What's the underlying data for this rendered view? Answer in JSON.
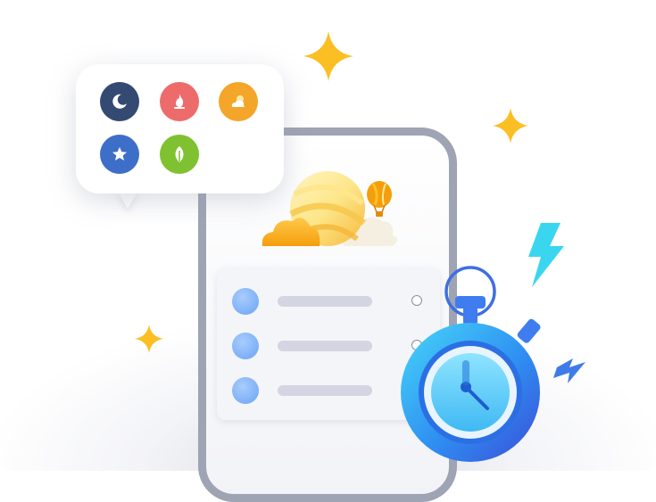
{
  "illustration": {
    "palette": {
      "moon": "#344a73",
      "fire": "#ee6b6b",
      "weather": "#f4a62a",
      "star": "#3e6fc8",
      "leaf": "#7fc130",
      "sparkle": "#fbbf24",
      "phone_frame": "#9ea4b4",
      "list_dot": "#7db1f8",
      "list_bar": "#d3d6e2",
      "stopwatch": "#2fb7f5",
      "lightning": "#3ad6f0"
    },
    "bubble_icons": [
      {
        "name": "moon-icon",
        "color": "#344a73"
      },
      {
        "name": "fire-icon",
        "color": "#ee6b6b"
      },
      {
        "name": "weather-icon",
        "color": "#f4a62a"
      },
      {
        "name": "star-icon",
        "color": "#3e6fc8"
      },
      {
        "name": "leaf-icon",
        "color": "#7fc130"
      }
    ],
    "list_rows": 3,
    "decorations": [
      "sparkle-icon",
      "sun-icon",
      "cloud-icon",
      "hot-air-balloon-icon",
      "stopwatch-icon",
      "lightning-icon"
    ]
  }
}
